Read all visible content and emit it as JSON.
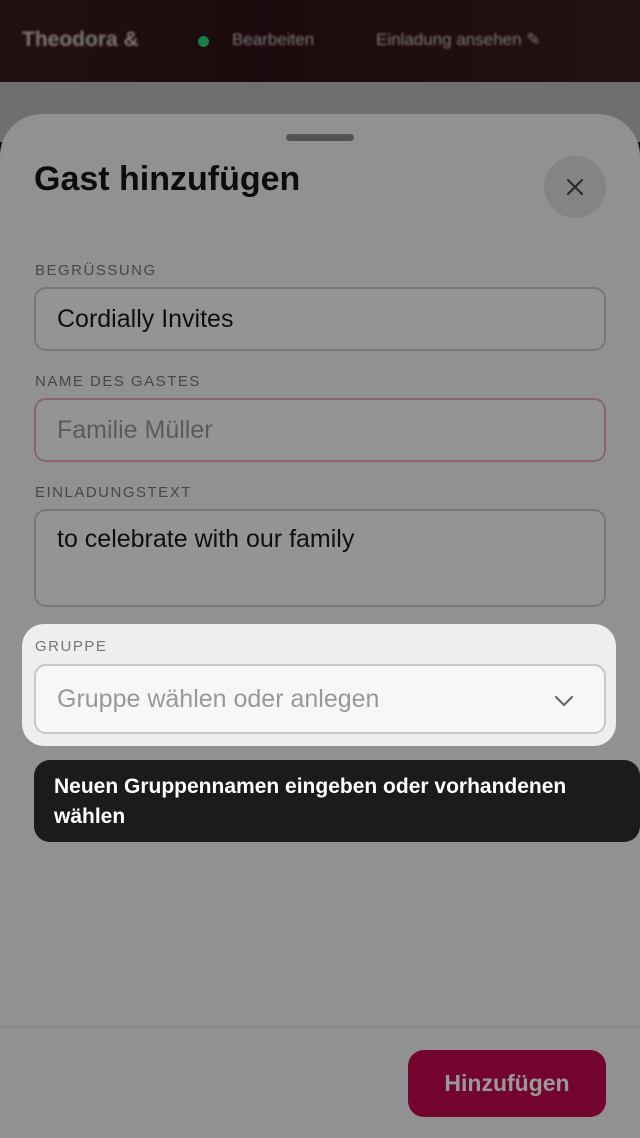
{
  "background_header": {
    "title": "Theodora &",
    "edit_label": "Bearbeiten",
    "invite_label": "Einladung ansehen ✎"
  },
  "sheet": {
    "title": "Gast hinzufügen"
  },
  "fields": {
    "greeting": {
      "label": "BEGRÜSSUNG",
      "value": "Cordially Invites"
    },
    "guest_name": {
      "label": "NAME DES GASTES",
      "placeholder": "Familie Müller"
    },
    "invitation_text": {
      "label": "EINLADUNGSTEXT",
      "value": "to celebrate with our family"
    },
    "group": {
      "label": "GRUPPE",
      "placeholder": "Gruppe wählen oder anlegen"
    }
  },
  "tooltip": {
    "text": "Neuen Gruppennamen eingeben oder vorhandenen wählen"
  },
  "footer": {
    "submit_label": "Hinzufügen"
  },
  "colors": {
    "accent": "#c0054f",
    "status_online": "#2bd07a",
    "error_border": "#e7a8bb"
  }
}
